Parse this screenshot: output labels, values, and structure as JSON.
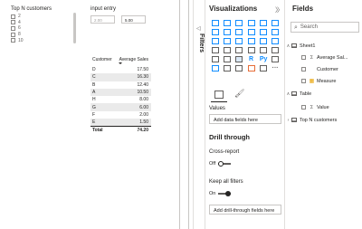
{
  "slicer": {
    "title": "Top N customers",
    "items": [
      "2",
      "4",
      "6",
      "8",
      "10"
    ]
  },
  "input": {
    "title": "input entry",
    "min_value": "2.00",
    "max_value": "5.00"
  },
  "table": {
    "headers": [
      "Customer",
      "Average Sales"
    ],
    "rows": [
      [
        "D",
        "17.50"
      ],
      [
        "C",
        "16.30"
      ],
      [
        "B",
        "12.40"
      ],
      [
        "A",
        "10.50"
      ],
      [
        "H",
        "8.00"
      ],
      [
        "G",
        "6.00"
      ],
      [
        "F",
        "2.00"
      ],
      [
        "E",
        "1.50"
      ]
    ],
    "total_label": "Total",
    "total_value": "74.20"
  },
  "filters": {
    "label": "Filters",
    "arrow": "◁"
  },
  "visualizations": {
    "title": "Visualizations",
    "collapse_arrow": "〉",
    "values_label": "Values",
    "values_placeholder": "Add data fields here",
    "drill_title": "Drill through",
    "cross_report_label": "Cross-report",
    "cross_report_state": "Off",
    "keep_filters_label": "Keep all filters",
    "keep_filters_state": "On",
    "drill_placeholder": "Add drill-through fields here",
    "format_glyph": "🖌",
    "more_glyph": "···",
    "r_glyph": "R",
    "py_glyph": "Py"
  },
  "fields": {
    "title": "Fields",
    "collapse_arrow": "〉",
    "search_placeholder": "Search",
    "search_glyph": "⌕",
    "tables": [
      {
        "name": "Sheet1",
        "fields": [
          {
            "kind": "Σ",
            "name": "Average Sal..."
          },
          {
            "kind": "",
            "name": "Customer"
          },
          {
            "kind": "measure",
            "name": "Measure"
          }
        ]
      },
      {
        "name": "Table",
        "fields": [
          {
            "kind": "Σ",
            "name": "Value"
          }
        ]
      },
      {
        "name": "Top N customers",
        "fields": []
      }
    ]
  },
  "colors": {
    "accent": "#118dff",
    "orange": "#e66c37",
    "measure": "#e9a300",
    "alt_row": "#eaeaea",
    "divider": "#c8c6c4"
  }
}
